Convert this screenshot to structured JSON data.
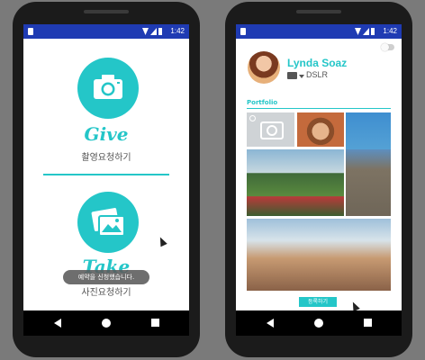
{
  "status_bar": {
    "time": "1:42"
  },
  "left_screen": {
    "give": {
      "title": "Give",
      "subtitle": "촬영요청하기",
      "icon": "camera-icon"
    },
    "take": {
      "title": "Take",
      "subtitle": "사진요청하기",
      "icon": "photos-icon"
    },
    "toast": "예약을 신청했습니다."
  },
  "right_screen": {
    "profile": {
      "name": "Lynda Soaz",
      "camera_type": "DSLR"
    },
    "portfolio_label": "Portfolio",
    "register_button": "등록하기"
  },
  "colors": {
    "accent": "#24c6c8",
    "status_bar": "#1f3bb3"
  }
}
